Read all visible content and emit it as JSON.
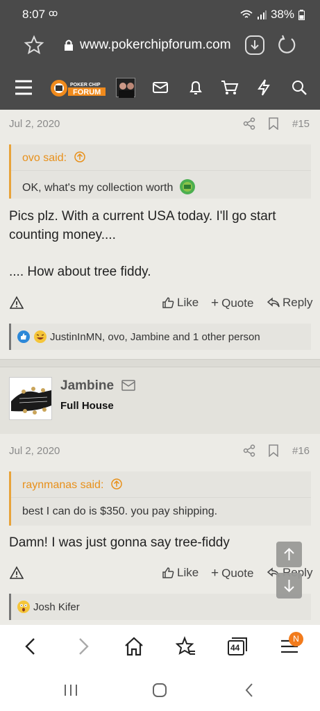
{
  "status": {
    "time": "8:07",
    "battery": "38%"
  },
  "browser": {
    "url": "www.pokerchipforum.com"
  },
  "logo": {
    "line1": "POKER CHIP",
    "line2": "FORUM"
  },
  "post15": {
    "date": "Jul 2, 2020",
    "number": "#15",
    "quote_author": "ovo said:",
    "quote_text": "OK, what's my collection worth",
    "text_line1": "Pics plz. With a current USA today. I'll go start",
    "text_line2": "counting money....",
    "text_line3": ".... How about tree fiddy.",
    "reactions": "JustinInMN, ovo, Jambine and 1 other person"
  },
  "actions": {
    "like": "Like",
    "quote": "Quote",
    "reply": "Reply"
  },
  "user16": {
    "name": "Jambine",
    "title": "Full House"
  },
  "post16": {
    "date": "Jul 2, 2020",
    "number": "#16",
    "quote_author": "raynmanas said:",
    "quote_text": "best I can do is $350. you pay shipping.",
    "text_line1": "Damn! I was just gonna say tree-fiddy",
    "reactions": "Josh Kifer"
  },
  "bottom_nav": {
    "tabs_count": "44",
    "menu_badge": "N"
  },
  "colors": {
    "accent": "#e8901a",
    "header": "#4a4a4a",
    "badge": "#f27b1c"
  }
}
